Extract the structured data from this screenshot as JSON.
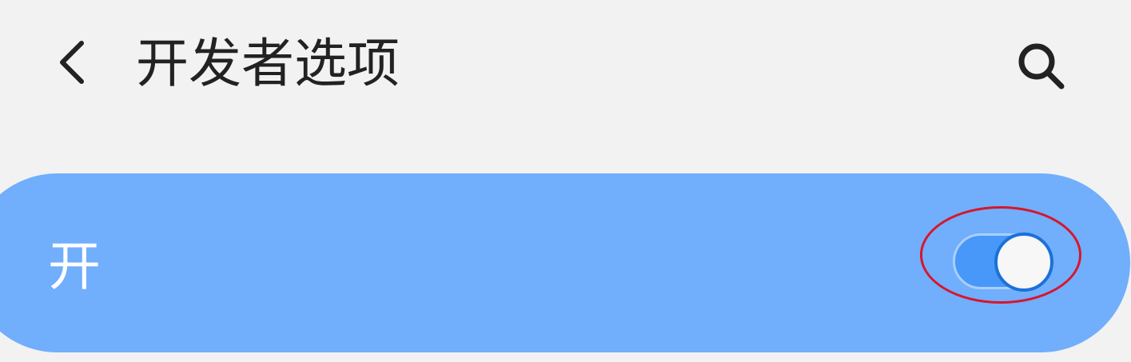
{
  "header": {
    "back_icon": "chevron-left-icon",
    "title": "开发者选项",
    "search_icon": "search-icon"
  },
  "master_switch": {
    "label": "开",
    "checked": true
  },
  "colors": {
    "background": "#f2f2f2",
    "row_highlight": "#71aefc",
    "toggle_track": "#4798f8",
    "toggle_thumb_border": "#1a72d8",
    "annotation_ring": "#d8162a"
  }
}
